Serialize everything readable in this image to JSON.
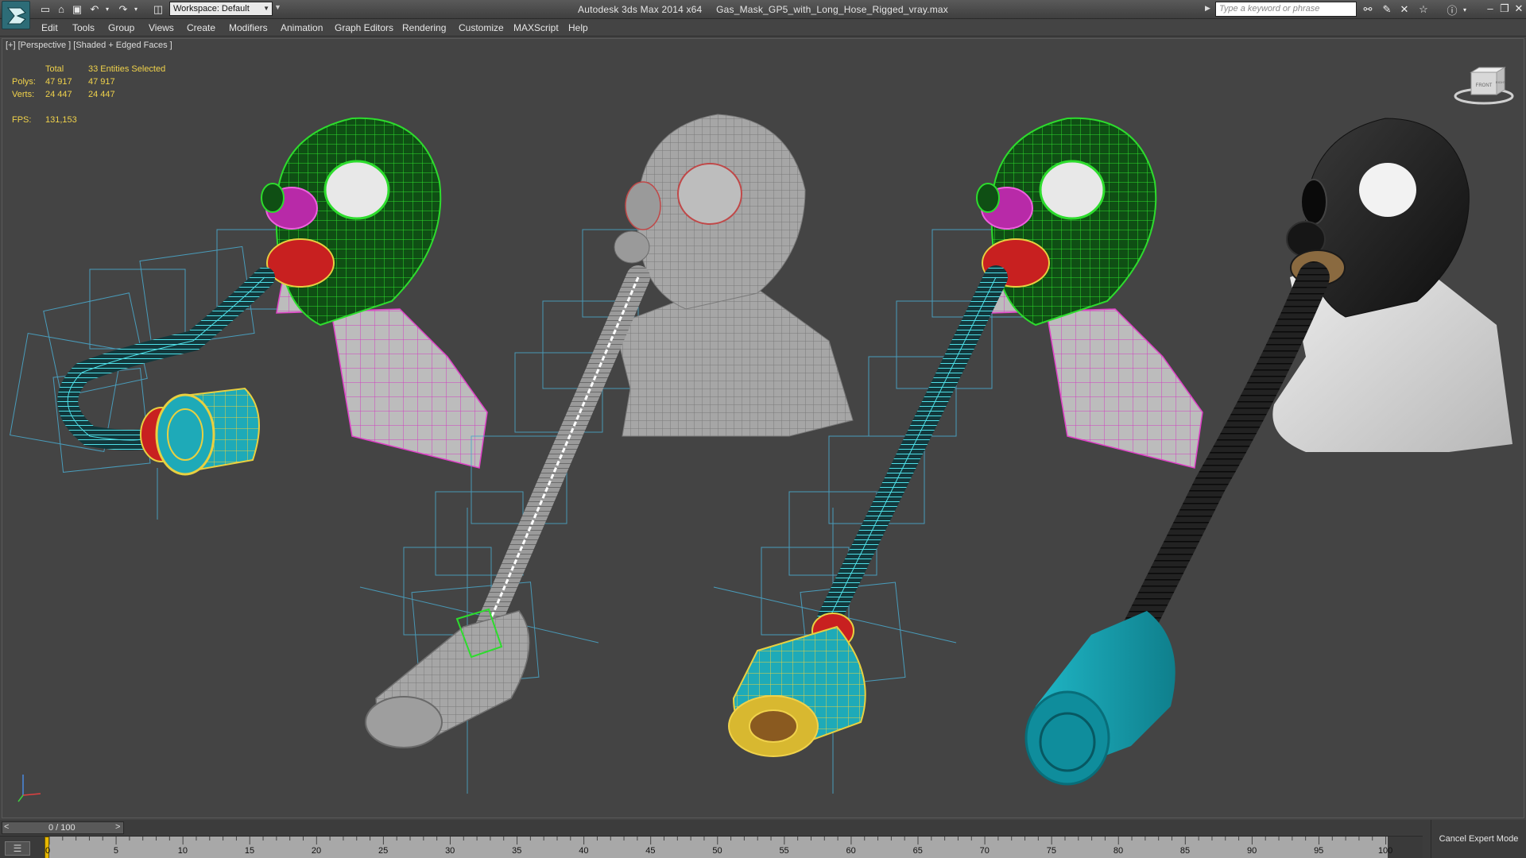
{
  "titlebar": {
    "app_title": "Autodesk 3ds Max  2014 x64",
    "file_name": "Gas_Mask_GP5_with_Long_Hose_Rigged_vray.max",
    "workspace_label": "Workspace: Default",
    "search_placeholder": "Type a keyword or phrase",
    "icons": [
      "new-file-icon",
      "open-file-icon",
      "save-file-icon",
      "undo-icon",
      "redo-icon",
      "project-folder-icon",
      "binoculars-icon",
      "subscription-icon",
      "communication-center-icon",
      "favorites-star-icon",
      "help-icon"
    ]
  },
  "menu": {
    "items": [
      "Edit",
      "Tools",
      "Group",
      "Views",
      "Create",
      "Modifiers",
      "Animation",
      "Graph Editors",
      "Rendering",
      "Customize",
      "MAXScript",
      "Help"
    ]
  },
  "viewport": {
    "label": "[+] [Perspective ] [Shaded + Edged Faces ]",
    "stats": {
      "total_header": "Total",
      "selected_header": "33 Entities Selected",
      "polys_label": "Polys:",
      "polys_total": "47 917",
      "polys_selected": "47 917",
      "verts_label": "Verts:",
      "verts_total": "24 447",
      "verts_selected": "24 447",
      "fps_label": "FPS:",
      "fps_value": "131,153"
    },
    "viewcube_labels": [
      "FRONT",
      "RIGHT"
    ],
    "colors": {
      "wire_green": "#1fd21f",
      "wire_pink": "#e040c8",
      "wire_cyan": "#40d8e0",
      "wire_yellow": "#f0d24b",
      "helper_blue": "#4aa6c8",
      "filter_teal": "#1aa7b8",
      "mask_black": "#1e1e1e",
      "bust_white": "#e2e2e2"
    }
  },
  "timeline": {
    "slider_text": "0 / 100",
    "prev": "<",
    "next": ">",
    "current_frame": "0",
    "ticks": [
      "5",
      "10",
      "15",
      "20",
      "25",
      "30",
      "35",
      "40",
      "45",
      "50",
      "55",
      "60",
      "65",
      "70",
      "75",
      "80",
      "85",
      "90",
      "95",
      "100"
    ]
  },
  "statusbar": {
    "cancel_expert": "Cancel Expert Mode"
  }
}
